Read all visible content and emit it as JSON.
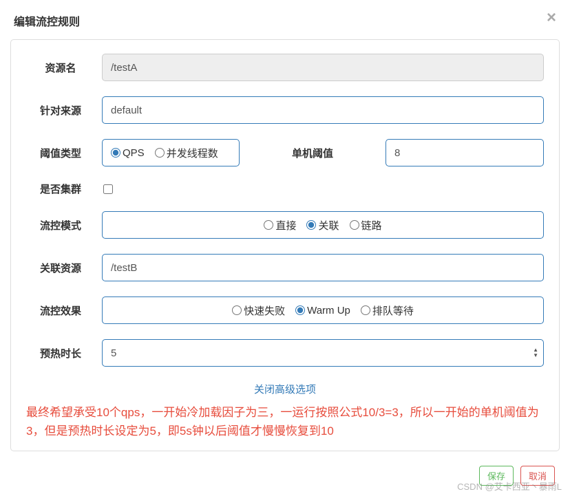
{
  "modal": {
    "title": "编辑流控规则",
    "close": "×"
  },
  "form": {
    "resourceName": {
      "label": "资源名",
      "value": "/testA"
    },
    "limitApp": {
      "label": "针对来源",
      "value": "default"
    },
    "thresholdType": {
      "label": "阈值类型",
      "options": {
        "qps": "QPS",
        "thread": "并发线程数"
      }
    },
    "threshold": {
      "label": "单机阈值",
      "value": "8"
    },
    "cluster": {
      "label": "是否集群"
    },
    "mode": {
      "label": "流控模式",
      "options": {
        "direct": "直接",
        "relate": "关联",
        "chain": "链路"
      }
    },
    "refResource": {
      "label": "关联资源",
      "value": "/testB"
    },
    "effect": {
      "label": "流控效果",
      "options": {
        "fast": "快速失败",
        "warmup": "Warm Up",
        "queue": "排队等待"
      }
    },
    "warmup": {
      "label": "预热时长",
      "value": "5"
    }
  },
  "toggleLink": "关闭高级选项",
  "note": "最终希望承受10个qps，一开始冷加载因子为三，一运行按照公式10/3=3，所以一开始的单机阈值为3，但是预热时长设定为5，即5s钟以后阈值才慢慢恢复到10",
  "buttons": {
    "save": "保存",
    "cancel": "取消"
  },
  "watermark": "CSDN @艾卡西亚丶暴雨L"
}
